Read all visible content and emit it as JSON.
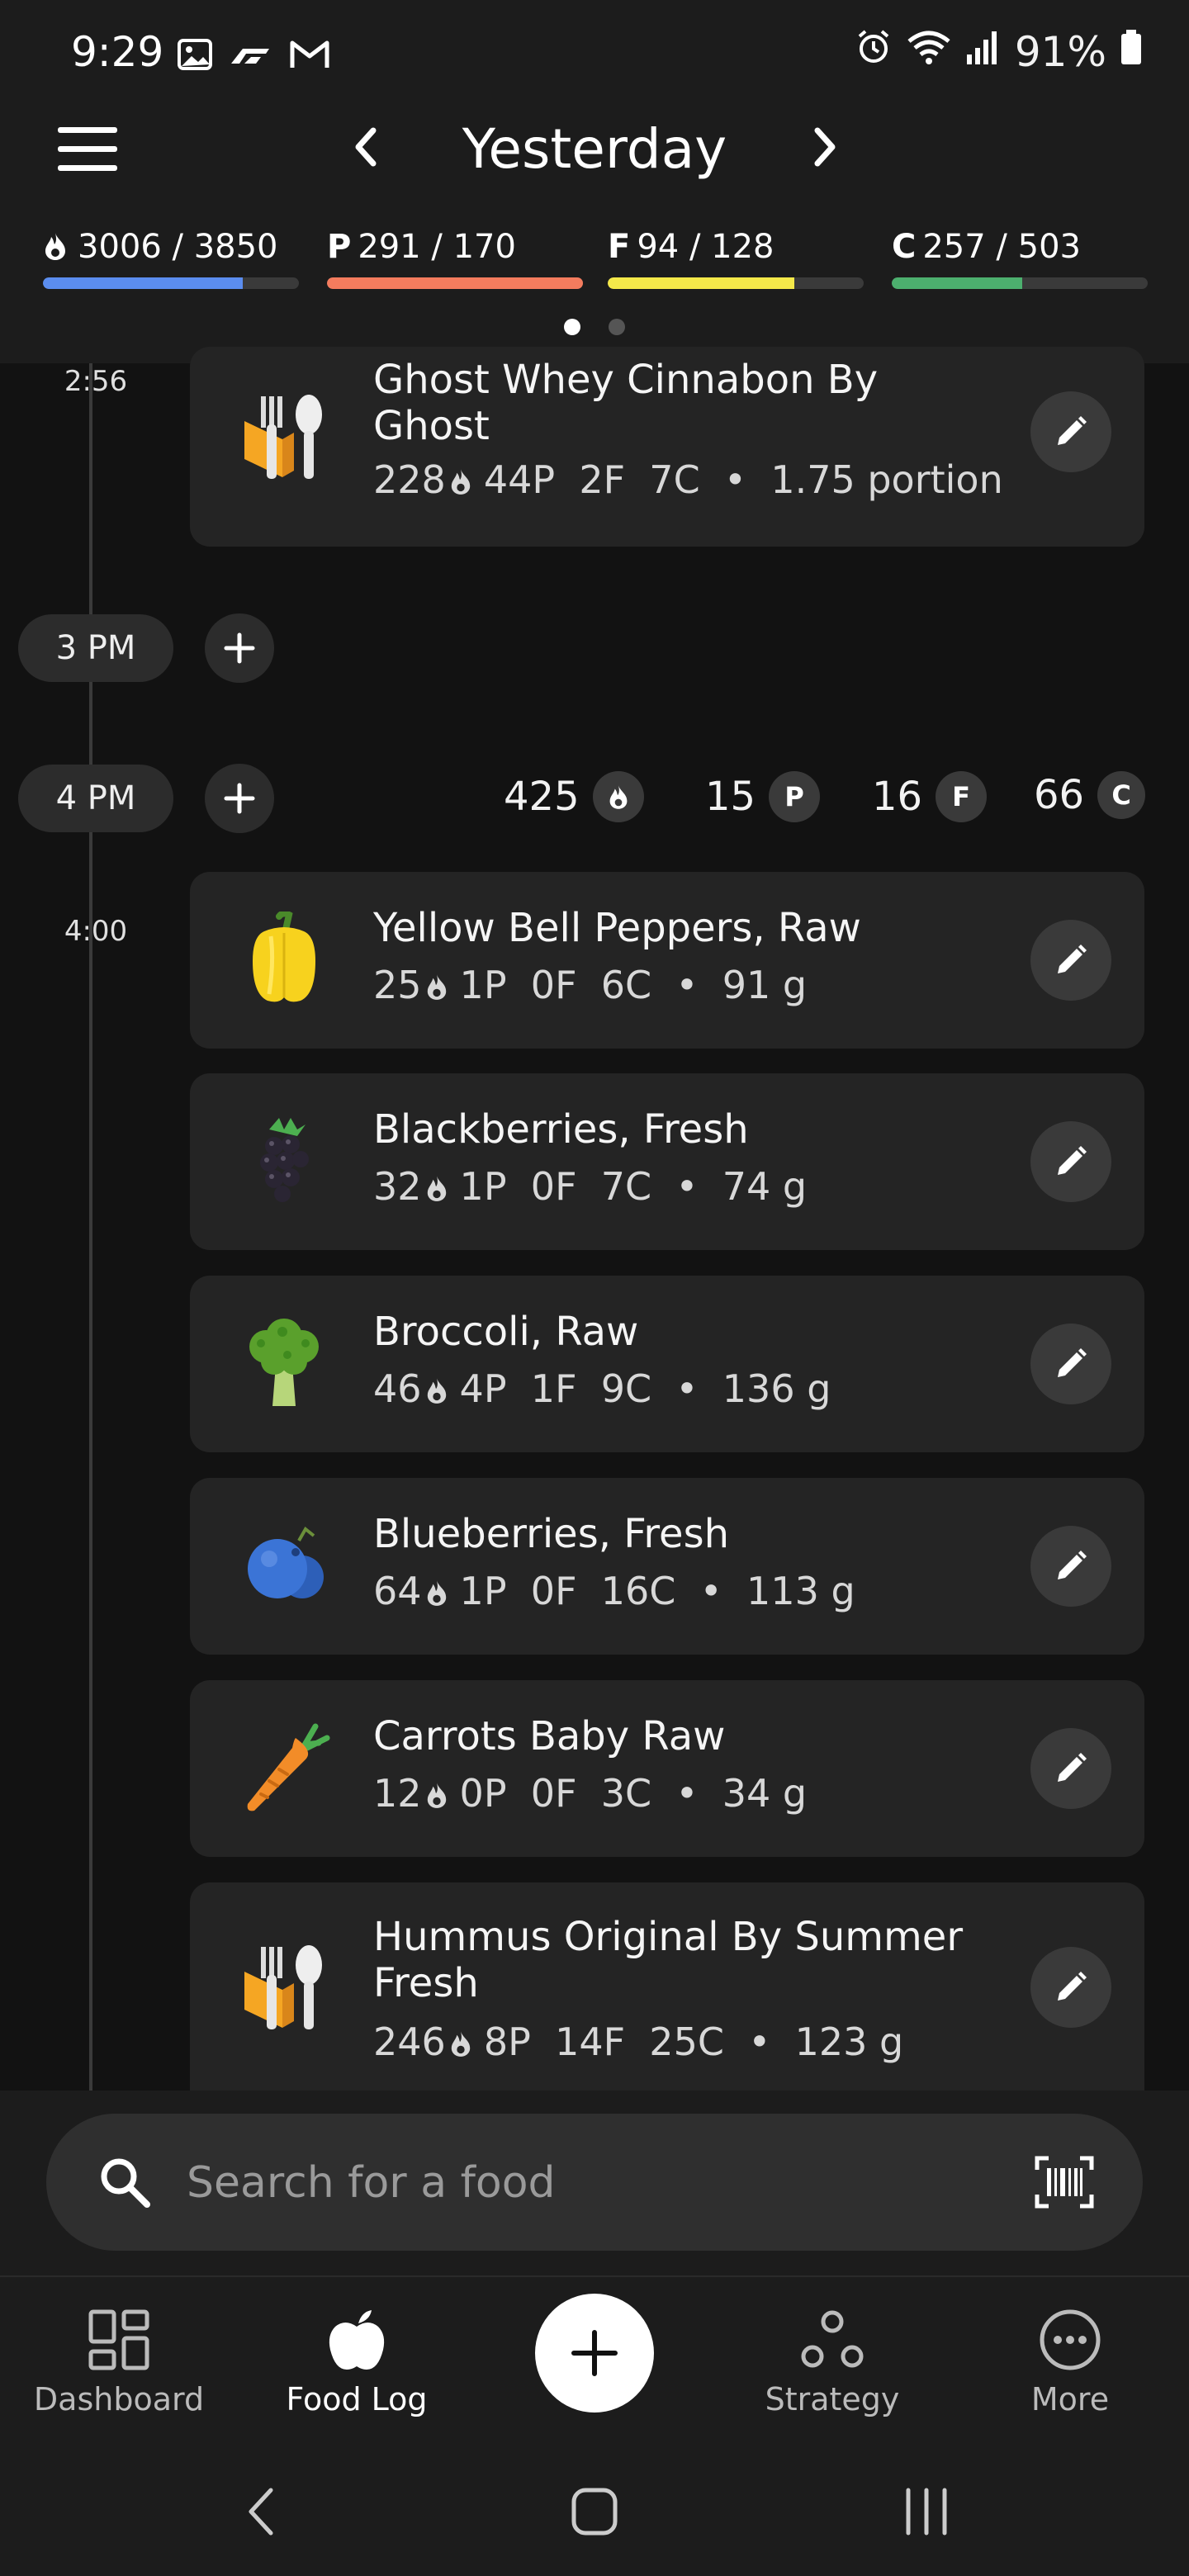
{
  "status_bar": {
    "time": "9:29",
    "battery": "91%"
  },
  "header": {
    "title": "Yesterday",
    "macros": [
      {
        "key": "calories",
        "prefix": "",
        "label": "3006 / 3850",
        "fraction": 0.78,
        "color": "#5b8def"
      },
      {
        "key": "protein",
        "prefix": "P",
        "label": "291 / 170",
        "fraction": 1.0,
        "color": "#f47c5e"
      },
      {
        "key": "fat",
        "prefix": "F",
        "label": "94 / 128",
        "fraction": 0.73,
        "color": "#f5e94a"
      },
      {
        "key": "carbs",
        "prefix": "C",
        "label": "257 / 503",
        "fraction": 0.51,
        "color": "#4caf6e"
      }
    ],
    "pages": {
      "count": 2,
      "active": 1
    }
  },
  "timeline": {
    "hours": [
      {
        "label": "3 PM"
      },
      {
        "label": "4 PM",
        "summary": {
          "cal": "425",
          "p": "15",
          "f": "16",
          "c": "66"
        }
      }
    ],
    "time_labels": [
      "2:56",
      "4:00"
    ],
    "badges": {
      "p": "P",
      "f": "F",
      "c": "C"
    }
  },
  "entries": [
    {
      "name": "Ghost Whey Cinnabon By Ghost",
      "cal": "228",
      "macros": "44P  2F  7C",
      "amount": "1.75 portion",
      "icon": "fork-knife-icon"
    },
    {
      "name": "Yellow Bell Peppers, Raw",
      "cal": "25",
      "macros": "1P  0F  6C",
      "amount": "91 g",
      "icon": "bell-pepper-icon"
    },
    {
      "name": "Blackberries, Fresh",
      "cal": "32",
      "macros": "1P  0F  7C",
      "amount": "74 g",
      "icon": "blackberry-icon"
    },
    {
      "name": "Broccoli, Raw",
      "cal": "46",
      "macros": "4P  1F  9C",
      "amount": "136 g",
      "icon": "broccoli-icon"
    },
    {
      "name": "Blueberries, Fresh",
      "cal": "64",
      "macros": "1P  0F  16C",
      "amount": "113 g",
      "icon": "blueberry-icon"
    },
    {
      "name": "Carrots Baby Raw",
      "cal": "12",
      "macros": "0P  0F  3C",
      "amount": "34 g",
      "icon": "carrot-icon"
    },
    {
      "name": "Hummus Original By Summer Fresh",
      "cal": "246",
      "macros": "8P  14F  25C",
      "amount": "123 g",
      "icon": "fork-knife-icon"
    }
  ],
  "search": {
    "placeholder": "Search for a food"
  },
  "nav": {
    "dashboard": "Dashboard",
    "food_log": "Food Log",
    "strategy": "Strategy",
    "more": "More",
    "active": "food_log"
  }
}
